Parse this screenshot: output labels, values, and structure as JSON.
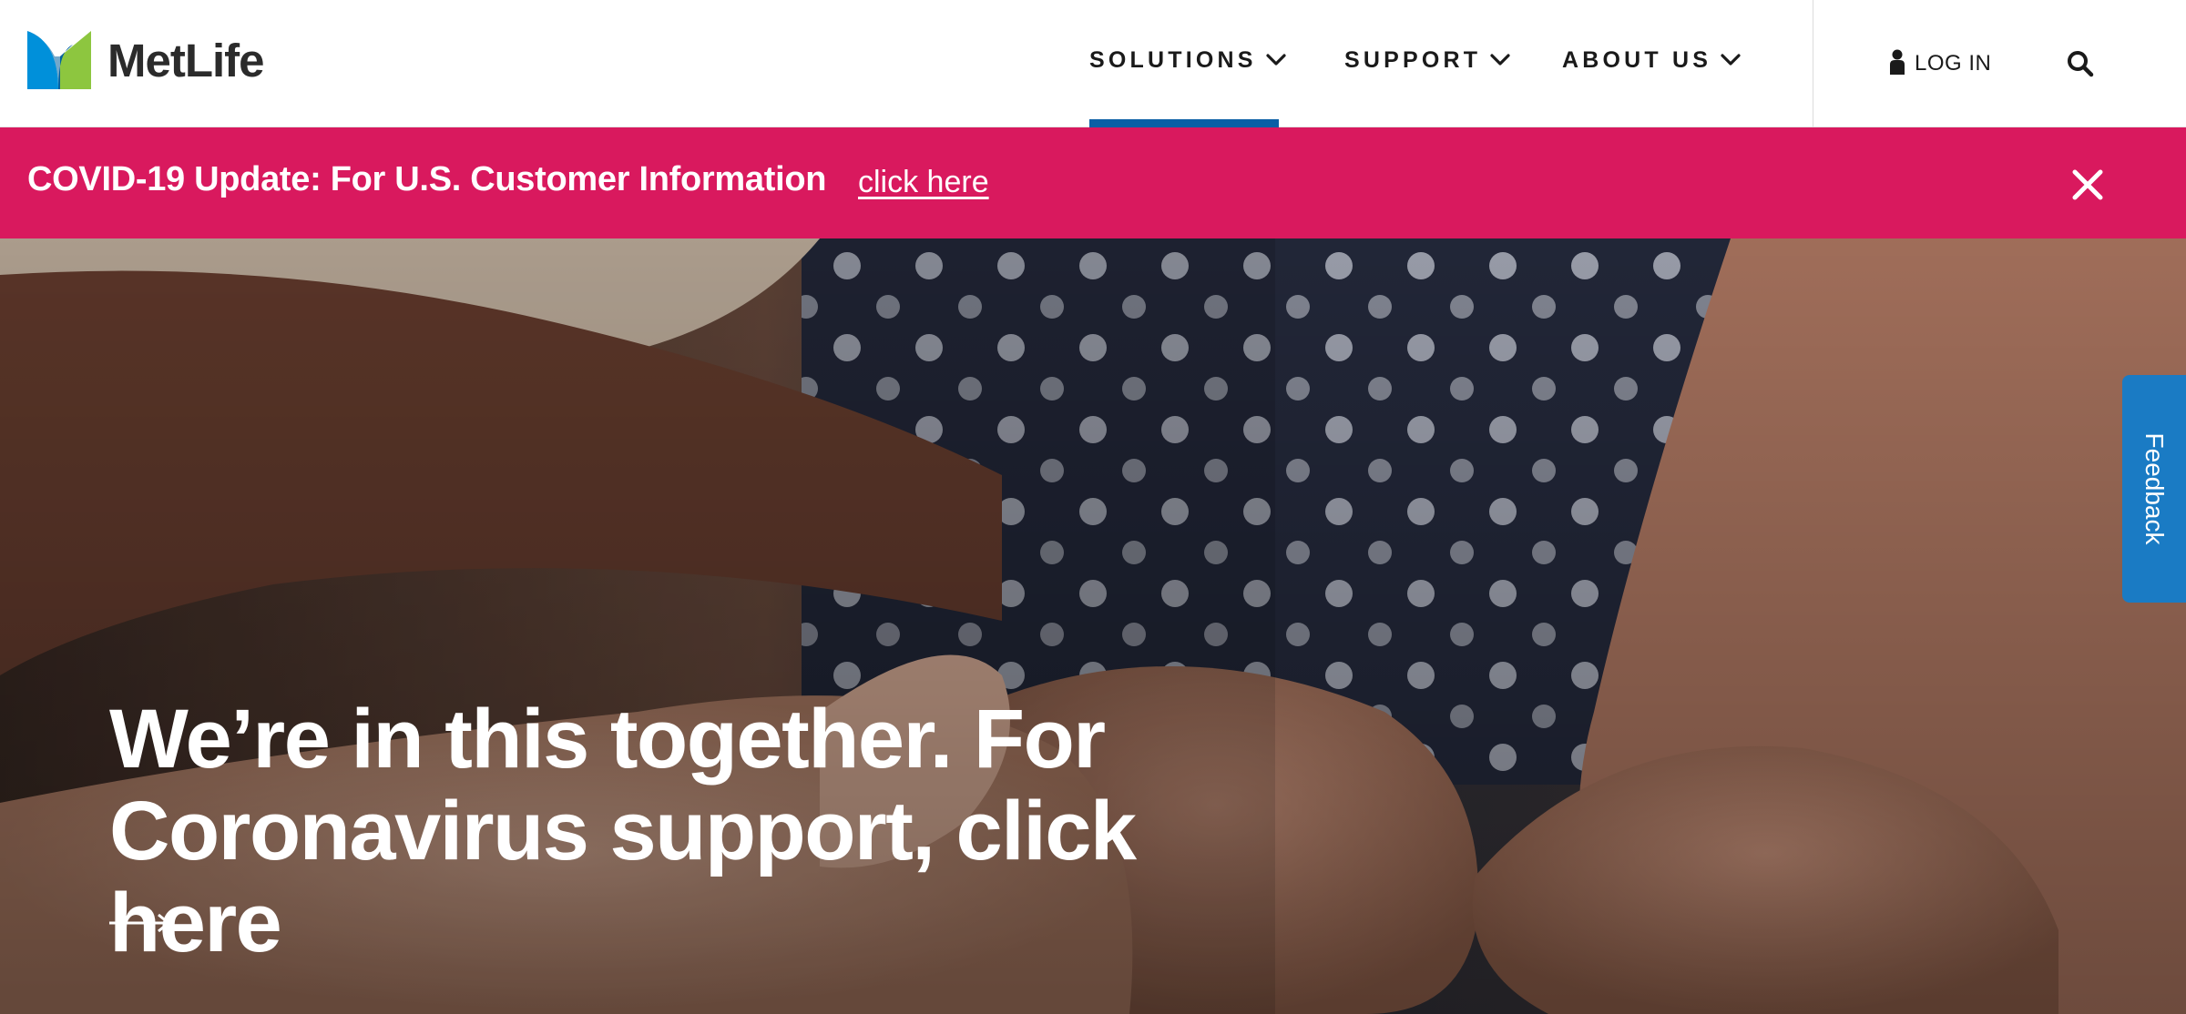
{
  "header": {
    "brand": "MetLife",
    "nav": [
      {
        "label": "SOLUTIONS",
        "active": true
      },
      {
        "label": "SUPPORT",
        "active": false
      },
      {
        "label": "ABOUT US",
        "active": false
      }
    ],
    "login_label": "LOG IN"
  },
  "banner": {
    "text": "COVID-19 Update: For U.S. Customer Information",
    "link": "click here"
  },
  "hero": {
    "line1": "We’re in this together. For",
    "line2": "Coronavirus support, click here"
  },
  "feedback_label": "Feedback",
  "colors": {
    "brand_blue": "#0b5fa5",
    "banner_pink": "#d9195e",
    "feedback_blue": "#1a7bc4",
    "logo_green": "#8dc63f",
    "logo_blue": "#0090da"
  },
  "icons": [
    "metlife-logo-icon",
    "chevron-down-icon",
    "person-icon",
    "search-icon",
    "close-icon",
    "arrow-right-icon"
  ]
}
